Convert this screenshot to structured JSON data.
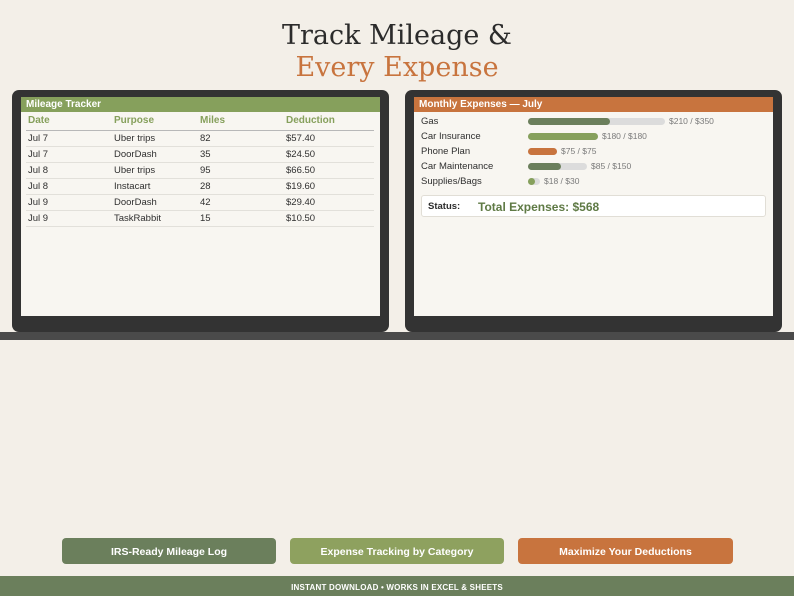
{
  "header": {
    "title_line1": "Track Mileage &",
    "title_line2": "Every Expense"
  },
  "mileage": {
    "title": "Mileage Tracker",
    "columns": [
      "Date",
      "Purpose",
      "Miles",
      "Deduction"
    ],
    "rows": [
      [
        "Jul 7",
        "Uber trips",
        "82",
        "$57.40"
      ],
      [
        "Jul 7",
        "DoorDash",
        "35",
        "$24.50"
      ],
      [
        "Jul 8",
        "Uber trips",
        "95",
        "$66.50"
      ],
      [
        "Jul 8",
        "Instacart",
        "28",
        "$19.60"
      ],
      [
        "Jul 9",
        "DoorDash",
        "42",
        "$29.40"
      ],
      [
        "Jul 9",
        "TaskRabbit",
        "15",
        "$10.50"
      ]
    ]
  },
  "expenses": {
    "title": "Monthly Expenses — July",
    "items": [
      {
        "name": "Gas",
        "amount": "$210 / $350",
        "spent": 210,
        "budget": 350,
        "color": "#6b7f5c"
      },
      {
        "name": "Car Insurance",
        "amount": "$180 / $180",
        "spent": 180,
        "budget": 180,
        "color": "#86a05c"
      },
      {
        "name": "Phone Plan",
        "amount": "$75 / $75",
        "spent": 75,
        "budget": 75,
        "color": "#c8743e"
      },
      {
        "name": "Car Maintenance",
        "amount": "$85 / $150",
        "spent": 85,
        "budget": 150,
        "color": "#6b7f5c"
      },
      {
        "name": "Supplies/Bags",
        "amount": "$18 / $30",
        "spent": 18,
        "budget": 30,
        "color": "#86a05c"
      }
    ],
    "status_label": "Status:",
    "total_text": "Total Expenses: $568"
  },
  "features": [
    "IRS-Ready Mileage Log",
    "Expense Tracking by Category",
    "Maximize Your Deductions"
  ],
  "footer": "INSTANT DOWNLOAD  •  WORKS IN EXCEL & SHEETS",
  "colors": {
    "background": "#f3efe8",
    "green": "#86a05c",
    "dark_green": "#6b7f5c",
    "orange": "#c8743e",
    "monitor": "#333333"
  }
}
